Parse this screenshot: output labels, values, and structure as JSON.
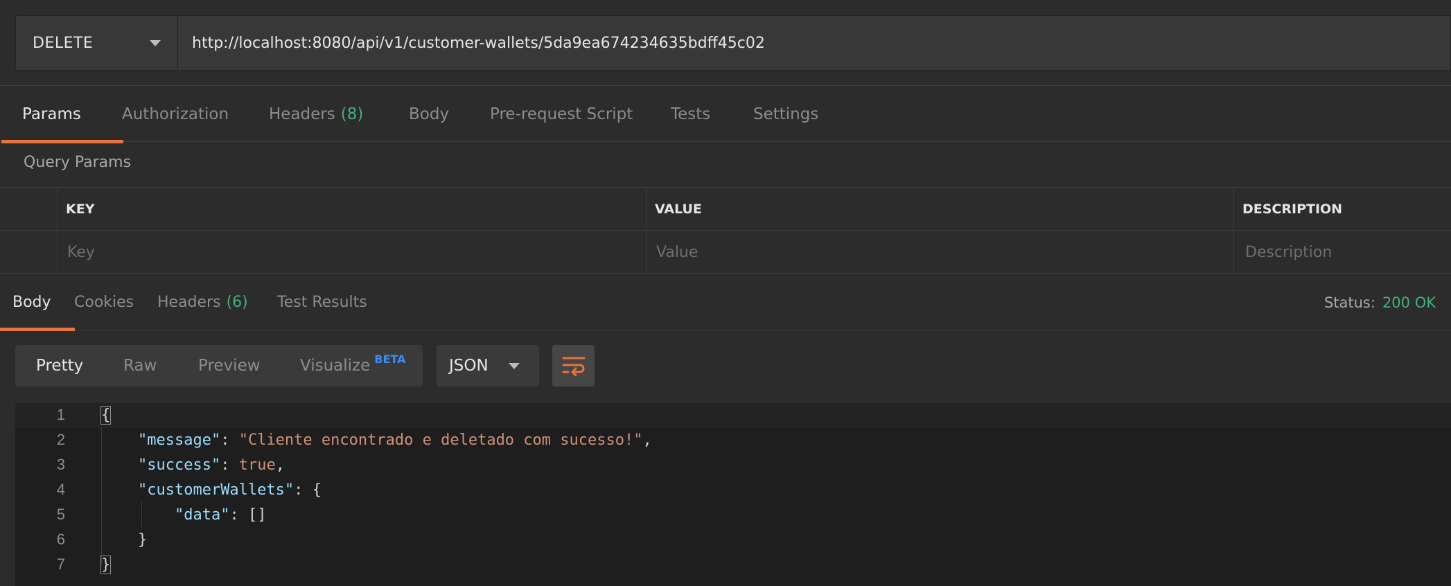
{
  "request": {
    "method": "DELETE",
    "url": "http://localhost:8080/api/v1/customer-wallets/5da9ea674234635bdff45c02"
  },
  "request_tabs": [
    {
      "label": "Params",
      "count": ""
    },
    {
      "label": "Authorization",
      "count": ""
    },
    {
      "label": "Headers",
      "count": "(8)"
    },
    {
      "label": "Body",
      "count": ""
    },
    {
      "label": "Pre-request Script",
      "count": ""
    },
    {
      "label": "Tests",
      "count": ""
    },
    {
      "label": "Settings",
      "count": ""
    }
  ],
  "query_params": {
    "title": "Query Params",
    "columns": [
      "KEY",
      "VALUE",
      "DESCRIPTION"
    ],
    "placeholders": [
      "Key",
      "Value",
      "Description"
    ]
  },
  "response_tabs": [
    {
      "label": "Body",
      "count": ""
    },
    {
      "label": "Cookies",
      "count": ""
    },
    {
      "label": "Headers",
      "count": "(6)"
    },
    {
      "label": "Test Results",
      "count": ""
    }
  ],
  "status": {
    "label": "Status:",
    "value": "200 OK"
  },
  "view_modes": [
    "Pretty",
    "Raw",
    "Preview",
    "Visualize"
  ],
  "beta_badge": "BETA",
  "format": "JSON",
  "icons": {
    "wrap": "wrap-lines-icon",
    "caret": "chevron-down-icon"
  },
  "colors": {
    "accent": "#e8743b",
    "success": "#3fb17a",
    "beta": "#3b8cf0"
  },
  "response_body": {
    "line_numbers": [
      "1",
      "2",
      "3",
      "4",
      "5",
      "6",
      "7"
    ],
    "open_brace": "{",
    "message_key": "\"message\"",
    "message_value": "\"Cliente encontrado e deletado com sucesso!\"",
    "success_key": "\"success\"",
    "success_value": "true",
    "wallets_key": "\"customerWallets\"",
    "data_key": "\"data\"",
    "data_value": "[]",
    "close_inner": "}",
    "close_brace": "}"
  }
}
